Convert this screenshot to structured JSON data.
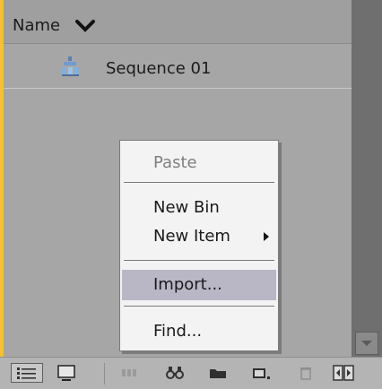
{
  "project_panel": {
    "column_header": "Name",
    "items": [
      {
        "label": "Sequence 01",
        "icon": "sequence-icon"
      }
    ]
  },
  "context_menu": {
    "items": [
      {
        "label": "Paste",
        "enabled": false
      },
      {
        "label": "New Bin",
        "enabled": true
      },
      {
        "label": "New Item",
        "enabled": true,
        "submenu": true
      },
      {
        "label": "Import...",
        "enabled": true,
        "highlighted": true
      },
      {
        "label": "Find...",
        "enabled": true
      }
    ]
  },
  "toolbar": {
    "buttons": [
      "list-view-icon",
      "icon-view-icon",
      "automate-to-sequence-icon",
      "find-icon",
      "new-bin-icon",
      "new-item-icon",
      "clear-icon",
      "panel-scroll-icon"
    ]
  },
  "colors": {
    "accent_left_border": "#f2c230",
    "menu_highlight": "#b9b7c6",
    "panel_bg": "#a6a6a6"
  }
}
